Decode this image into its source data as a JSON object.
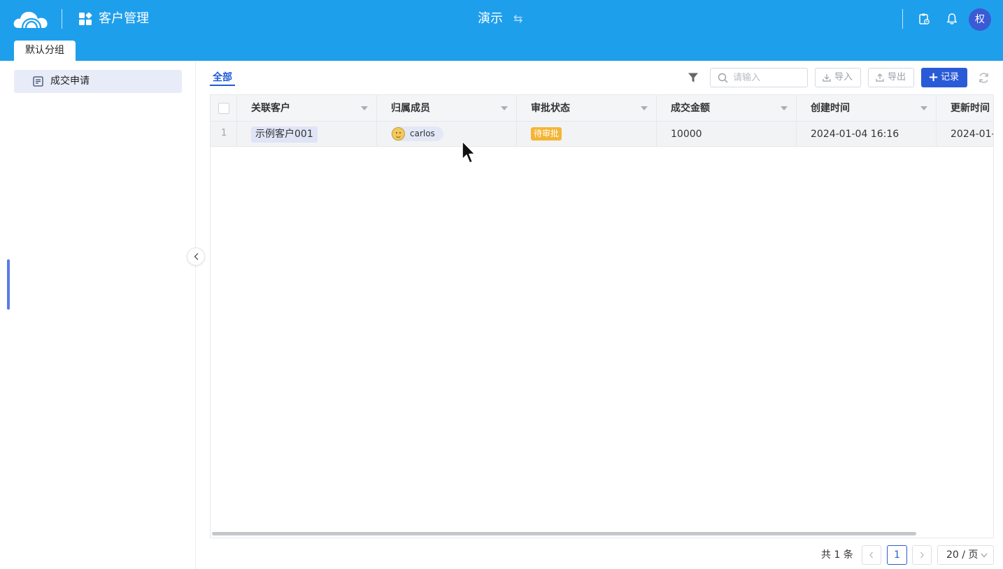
{
  "header": {
    "app_title": "客户管理",
    "workspace_title": "演示",
    "avatar_initial": "权",
    "group_tab": "默认分组",
    "brand_color": "#1e9fec",
    "icons": [
      "cloud-logo-icon",
      "apps-grid-icon",
      "swap-icon",
      "clipboard-icon",
      "bell-icon"
    ]
  },
  "sidebar": {
    "items": [
      {
        "label": "成交申请",
        "icon": "form-icon",
        "active": true
      }
    ]
  },
  "toolbar": {
    "view_tab": "全部",
    "search_placeholder": "请输入",
    "import_label": "导入",
    "export_label": "导出",
    "add_label": "记录",
    "accent_color": "#2a5bd7"
  },
  "table": {
    "columns": [
      "关联客户",
      "归属成员",
      "审批状态",
      "成交金额",
      "创建时间",
      "更新时间"
    ],
    "rows": [
      {
        "row_number": "1",
        "customer": "示例客户001",
        "member": "carlos",
        "status": "待审批",
        "amount": "10000",
        "created": "2024-01-04 16:16",
        "updated": "2024-01-"
      }
    ]
  },
  "pagination": {
    "total": "共 1 条",
    "current_page": "1",
    "page_size": "20 / 页"
  }
}
